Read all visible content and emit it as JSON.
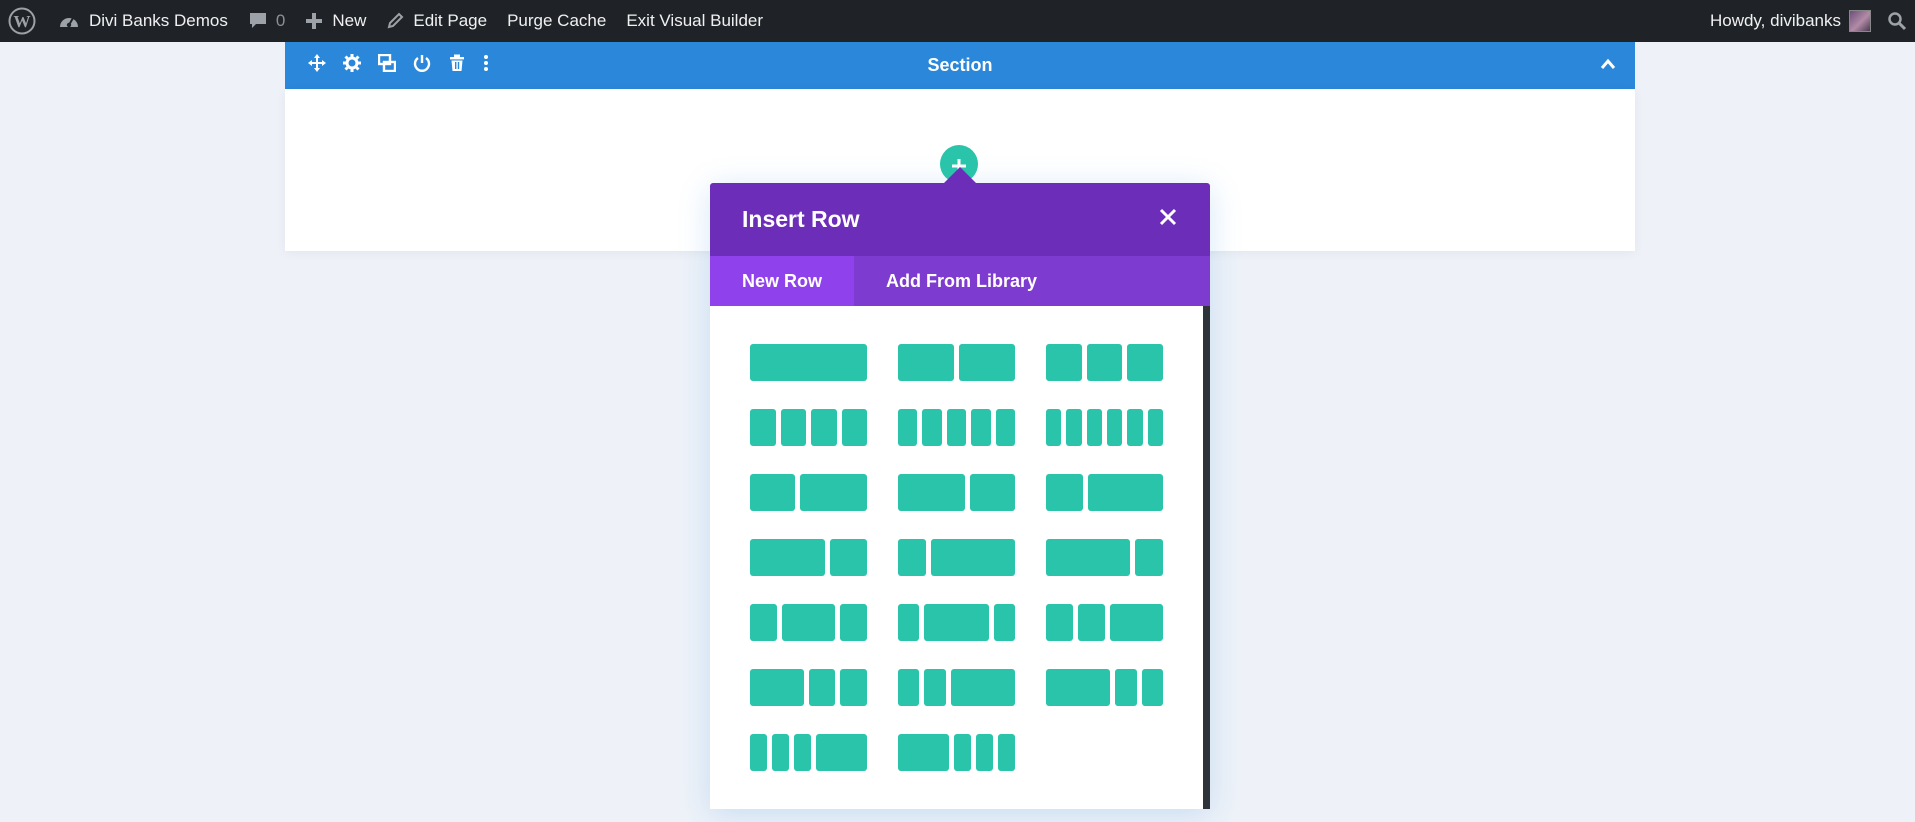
{
  "admin_bar": {
    "site_name": "Divi Banks Demos",
    "comments_count": "0",
    "new_label": "New",
    "edit_page_label": "Edit Page",
    "purge_cache_label": "Purge Cache",
    "exit_builder_label": "Exit Visual Builder",
    "greeting": "Howdy, divibanks"
  },
  "section": {
    "title": "Section",
    "color": "#2b87da",
    "tools": [
      "move-icon",
      "gear-icon",
      "duplicate-icon",
      "power-icon",
      "trash-icon",
      "more-icon"
    ]
  },
  "modal": {
    "title": "Insert Row",
    "tabs": [
      {
        "label": "New Row",
        "active": true
      },
      {
        "label": "Add From Library",
        "active": false
      }
    ],
    "header_color": "#6c2eb9",
    "accent_color": "#29c4a9",
    "layouts": [
      {
        "name": "1",
        "cols": [
          1
        ]
      },
      {
        "name": "1/2 1/2",
        "cols": [
          1,
          1
        ]
      },
      {
        "name": "1/3 1/3 1/3",
        "cols": [
          1,
          1,
          1
        ]
      },
      {
        "name": "1/4 x4",
        "cols": [
          1,
          1,
          1,
          1
        ]
      },
      {
        "name": "1/5 x5",
        "cols": [
          1,
          1,
          1,
          1,
          1
        ]
      },
      {
        "name": "1/6 x6",
        "cols": [
          1,
          1,
          1,
          1,
          1,
          1
        ]
      },
      {
        "name": "2/5 3/5",
        "cols": [
          2,
          3
        ]
      },
      {
        "name": "3/5 2/5",
        "cols": [
          3,
          2
        ]
      },
      {
        "name": "1/3 2/3",
        "cols": [
          1,
          2
        ]
      },
      {
        "name": "2/3 1/3",
        "cols": [
          2,
          1
        ]
      },
      {
        "name": "1/4 3/4",
        "cols": [
          1,
          3
        ]
      },
      {
        "name": "3/4 1/4",
        "cols": [
          3,
          1
        ]
      },
      {
        "name": "1/4 1/2 1/4",
        "cols": [
          1,
          2,
          1
        ]
      },
      {
        "name": "1/5 3/5 1/5",
        "cols": [
          1,
          3,
          1
        ]
      },
      {
        "name": "1/4 1/4 1/2",
        "cols": [
          1,
          1,
          2
        ]
      },
      {
        "name": "1/2 1/4 1/4",
        "cols": [
          2,
          1,
          1
        ]
      },
      {
        "name": "1/5 1/5 3/5",
        "cols": [
          1,
          1,
          3
        ]
      },
      {
        "name": "3/5 1/5 1/5",
        "cols": [
          3,
          1,
          1
        ]
      },
      {
        "name": "1/6 1/6 1/6 1/2",
        "cols": [
          1,
          1,
          1,
          3
        ]
      },
      {
        "name": "1/2 1/6 1/6 1/6",
        "cols": [
          3,
          1,
          1,
          1
        ]
      }
    ]
  }
}
